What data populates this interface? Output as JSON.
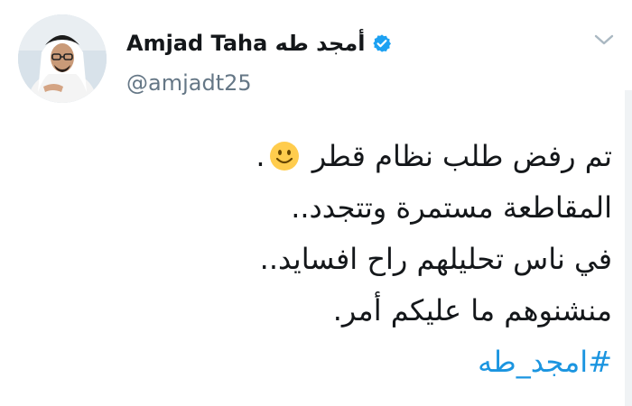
{
  "author": {
    "display_name": "Amjad Taha أمجد طه",
    "handle": "@amjadt25",
    "verified": true,
    "avatar_icon": "avatar-man-in-ghutra"
  },
  "tweet": {
    "line1_start": "تم رفض طلب نظام قطر",
    "line1_emoji": "slightly-smiling-face-icon",
    "line1_end": ".",
    "line2": "المقاطعة مستمرة وتتجدد..",
    "line3": "في ناس تحليلهم راح افسايد..",
    "line4": "منشنوهم ما عليكم أمر.",
    "hashtag": "#امجد_طه"
  },
  "colors": {
    "verified": "#1da1f2",
    "hashtag": "#1b95e0",
    "handle": "#657786",
    "text": "#14171a"
  }
}
